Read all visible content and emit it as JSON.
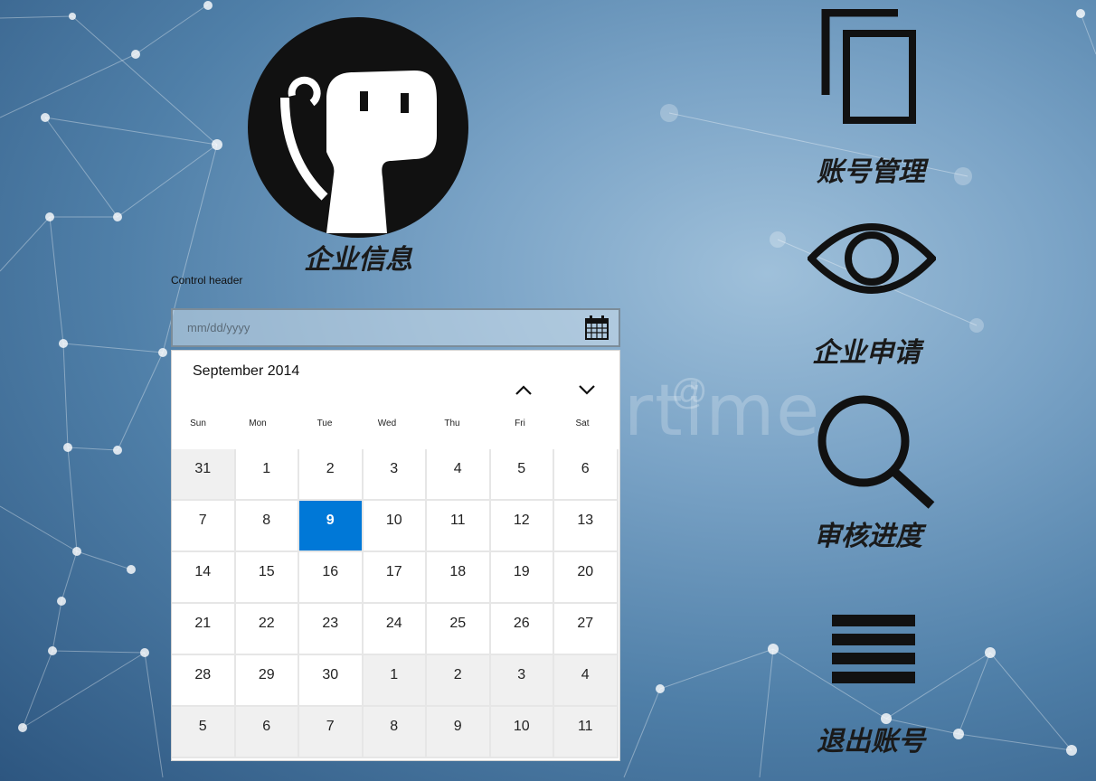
{
  "enterprise": {
    "caption": "企业信息",
    "avatar_icon": "robot-avatar-icon"
  },
  "datepicker": {
    "header": "Control header",
    "placeholder": "mm/dd/yyyy",
    "value": "",
    "calendar_icon": "calendar-icon",
    "month_label": "September 2014",
    "selected_day": "9",
    "weekdays": [
      "Sun",
      "Mon",
      "Tue",
      "Wed",
      "Thu",
      "Fri",
      "Sat"
    ],
    "weeks": [
      [
        "31",
        "1",
        "2",
        "3",
        "4",
        "5",
        "6"
      ],
      [
        "7",
        "8",
        "9",
        "10",
        "11",
        "12",
        "13"
      ],
      [
        "14",
        "15",
        "16",
        "17",
        "18",
        "19",
        "20"
      ],
      [
        "21",
        "22",
        "23",
        "24",
        "25",
        "26",
        "27"
      ],
      [
        "28",
        "29",
        "30",
        "1",
        "2",
        "3",
        "4"
      ],
      [
        "5",
        "6",
        "7",
        "8",
        "9",
        "10",
        "11"
      ]
    ],
    "selected_color": "#0078d7"
  },
  "menu": {
    "account_management": "账号管理",
    "enterprise_application": "企业申请",
    "review_progress": "审核进度",
    "logout": "退出账号"
  },
  "background": {
    "watermark": "rtime"
  }
}
